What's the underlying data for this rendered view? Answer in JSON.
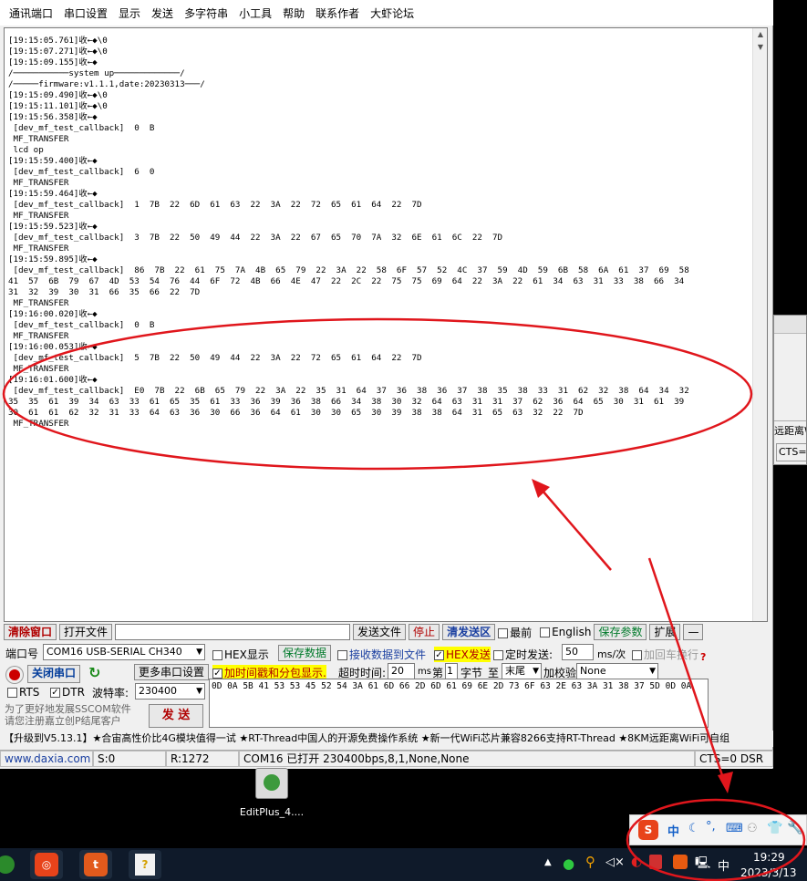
{
  "menu": [
    "通讯端口",
    "串口设置",
    "显示",
    "发送",
    "多字符串",
    "小工具",
    "帮助",
    "联系作者",
    "大虾论坛"
  ],
  "recv": {
    "lines": [
      "[19:15:05.761]收←◆\\0",
      "[19:15:07.271]收←◆\\0",
      "[19:15:09.155]收←◆",
      "/───────────system up─────────────/",
      "/─────firmware:v1.1.1,date:20230313───/",
      "[19:15:09.490]收←◆\\0",
      "[19:15:11.101]收←◆\\0",
      "[19:15:56.358]收←◆",
      " [dev_mf_test_callback]  0  B",
      " MF_TRANSFER",
      " lcd op",
      "[19:15:59.400]收←◆",
      " [dev_mf_test_callback]  6  0",
      " MF_TRANSFER",
      "[19:15:59.464]收←◆",
      " [dev_mf_test_callback]  1  7B  22  6D  61  63  22  3A  22  72  65  61  64  22  7D",
      " MF_TRANSFER",
      "[19:15:59.523]收←◆",
      " [dev_mf_test_callback]  3  7B  22  50  49  44  22  3A  22  67  65  70  7A  32  6E  61  6C  22  7D",
      " MF_TRANSFER",
      "[19:15:59.895]收←◆",
      " [dev_mf_test_callback]  86  7B  22  61  75  7A  4B  65  79  22  3A  22  58  6F  57  52  4C  37  59  4D  59  6B  58  6A  61  37  69  58",
      "41  57  6B  79  67  4D  53  54  76  44  6F  72  4B  66  4E  47  22  2C  22  75  75  69  64  22  3A  22  61  34  63  31  33  38  66  34",
      "31  32  39  30  31  66  35  66  22  7D",
      " MF_TRANSFER",
      "[19:16:00.020]收←◆",
      " [dev_mf_test_callback]  0  B",
      " MF_TRANSFER",
      "[19:16:00.053]收←◆",
      " [dev_mf_test_callback]  5  7B  22  50  49  44  22  3A  22  72  65  61  64  22  7D",
      " MF_TRANSFER",
      "[19:16:01.600]收←◆",
      " [dev_mf_test_callback]  E0  7B  22  6B  65  79  22  3A  22  35  31  64  37  36  38  36  37  38  35  38  33  31  62  32  38  64  34  32",
      "35  35  61  39  34  63  33  61  65  35  61  33  36  39  36  38  66  34  38  30  32  64  63  31  31  37  62  36  64  65  30  31  61  39",
      "30  61  61  62  32  31  33  64  63  36  30  66  36  64  61  30  30  65  30  39  38  38  64  31  65  63  32  22  7D",
      " MF_TRANSFER"
    ]
  },
  "toolbar1": {
    "clear": "清除窗口",
    "open_file": "打开文件",
    "send_file": "发送文件",
    "stop": "停止",
    "clear_send": "清发送区",
    "topmost": "最前",
    "english": "English",
    "save_params": "保存参数",
    "expand": "扩展",
    "collapse": "—"
  },
  "port": {
    "label": "端口号",
    "value": "COM16 USB-SERIAL CH340",
    "close_btn": "关闭串口",
    "more": "更多串口设置",
    "rts": "RTS",
    "dtr": "DTR",
    "baud_label": "波特率:",
    "baud": "230400"
  },
  "options": {
    "hex_display": "HEX显示",
    "save_data": "保存数据",
    "recv_to_file": "接收数据到文件",
    "hex_send": "HEX发送",
    "timed_send": "定时发送:",
    "interval": "50",
    "interval_unit": "ms/次",
    "add_newline": "加回车换行",
    "timestamp": "加时间戳和分包显示.",
    "timeout_label": "超时时间:",
    "timeout": "20",
    "timeout_unit": "ms",
    "nth": "第",
    "byte_no": "1",
    "byte_label": "字节",
    "to": "至",
    "tail": "末尾",
    "checksum_label": "加校验",
    "checksum": "None",
    "question": "?"
  },
  "send": {
    "content": "0D 0A 5B 41 53 53 45 52 54 3A 61 6D 66 2D 6D 61 69 6E 2D 73 6F 63 2E 63 3A 31 38 37 5D 0D 0A",
    "button": "发 送",
    "promo": "为了更好地发展SSCOM软件\n请您注册嘉立创P结尾客户"
  },
  "adbar": "【升级到V5.13.1】★合宙高性价比4G模块值得一试 ★RT-Thread中国人的开源免费操作系统 ★新一代WiFi芯片兼容8266支持RT-Thread ★8KM远距离WiFi可自组",
  "status": {
    "site": "www.daxia.com",
    "sent": "S:0",
    "recv": "R:1272",
    "port": "COM16 已打开  230400bps,8,1,None,None",
    "signals": "CTS=0 DSR"
  },
  "side_window": {
    "line1": "远距离W",
    "line2": "CTS="
  },
  "desktop": {
    "icon_label": "EditPlus_4...."
  },
  "tray": {
    "ime": "中",
    "ime2": "中",
    "time": "19:29",
    "date": "2023/3/13"
  },
  "colors": {
    "annotation": "#e0161c",
    "sogou": "#e8431a"
  }
}
